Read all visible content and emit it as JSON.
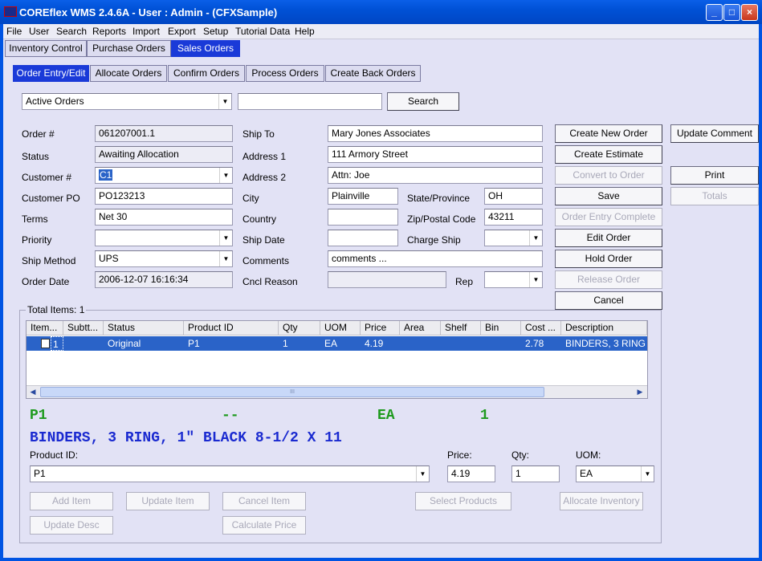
{
  "window": {
    "title": "COREflex WMS 2.4.6A - User : Admin - (CFXSample)",
    "minimize": "_",
    "maximize": "□",
    "close": "×"
  },
  "menu": [
    "File",
    "User",
    "Search",
    "Reports",
    "Import",
    "Export",
    "Setup",
    "Tutorial Data",
    "Help"
  ],
  "main_tabs": [
    "Inventory Control",
    "Purchase Orders",
    "Sales Orders"
  ],
  "sub_tabs": [
    "Order Entry/Edit",
    "Allocate Orders",
    "Confirm Orders",
    "Process Orders",
    "Create Back Orders"
  ],
  "filter": {
    "value": "Active Orders",
    "search_text": "",
    "search_button": "Search"
  },
  "labels": {
    "order_no": "Order #",
    "status": "Status",
    "customer_no": "Customer #",
    "customer_po": "Customer PO",
    "terms": "Terms",
    "priority": "Priority",
    "ship_method": "Ship Method",
    "order_date": "Order Date",
    "ship_to": "Ship To",
    "address1": "Address 1",
    "address2": "Address 2",
    "city": "City",
    "country": "Country",
    "ship_date": "Ship Date",
    "comments": "Comments",
    "cncl_reason": "Cncl Reason",
    "state": "State/Province",
    "zip": "Zip/Postal Code",
    "charge_ship": "Charge Ship",
    "rep": "Rep"
  },
  "values": {
    "order_no": "061207001.1",
    "status": "Awaiting Allocation",
    "customer_no": "C1",
    "customer_po": "PO123213",
    "terms": "Net 30",
    "priority": "",
    "ship_method": "UPS",
    "order_date": "2006-12-07 16:16:34",
    "ship_to": "Mary Jones Associates",
    "address1": "111 Armory Street",
    "address2": "Attn: Joe",
    "city": "Plainville",
    "country": "",
    "ship_date": "",
    "comments": "comments ...",
    "cncl_reason": "",
    "state": "OH",
    "zip": "43211",
    "charge_ship": "",
    "rep": ""
  },
  "actions": {
    "create_new_order": "Create New Order",
    "create_estimate": "Create Estimate",
    "convert_to_order": "Convert to Order",
    "save": "Save",
    "order_entry_complete": "Order Entry Complete",
    "edit_order": "Edit Order",
    "hold_order": "Hold Order",
    "release_order": "Release Order",
    "cancel": "Cancel",
    "update_comment": "Update Comment",
    "print": "Print",
    "totals": "Totals"
  },
  "items": {
    "total_label": "Total Items: 1",
    "columns": [
      "Item...",
      "Subtt...",
      "Status",
      "Product ID",
      "Qty",
      "UOM",
      "Price",
      "Area",
      "Shelf",
      "Bin",
      "Cost ...",
      "Description"
    ],
    "rows": [
      [
        "1",
        "",
        "Original",
        "P1",
        "1",
        "EA",
        "4.19",
        "",
        "",
        "",
        "2.78",
        "BINDERS, 3 RING"
      ]
    ],
    "scroll_grip": "III"
  },
  "selected": {
    "product": "P1",
    "dash": "--",
    "uom": "EA",
    "qty": "1",
    "description": "BINDERS, 3 RING, 1\" BLACK 8-1/2 X 11"
  },
  "item_form": {
    "product_label": "Product ID:",
    "product_value": "P1",
    "price_label": "Price:",
    "price_value": "4.19",
    "qty_label": "Qty:",
    "qty_value": "1",
    "uom_label": "UOM:",
    "uom_value": "EA",
    "add_item": "Add Item",
    "update_item": "Update Item",
    "cancel_item": "Cancel Item",
    "select_products": "Select Products",
    "allocate_inventory": "Allocate Inventory",
    "update_desc": "Update Desc",
    "calculate_price": "Calculate Price"
  },
  "colors": {
    "selected_tab": "#1a3ad8",
    "selected_row": "#2a63c8",
    "green_text": "#1e9a1e",
    "blue_text": "#1a2ad0"
  }
}
